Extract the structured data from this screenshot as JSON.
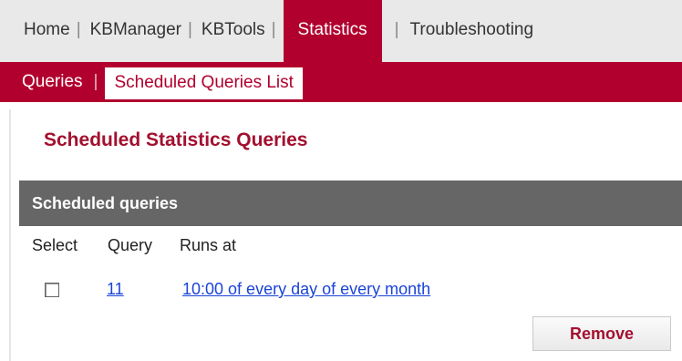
{
  "nav": {
    "tabs": [
      {
        "label": "Home"
      },
      {
        "label": "KBManager"
      },
      {
        "label": "KBTools"
      },
      {
        "label": "Statistics"
      },
      {
        "label": "Troubleshooting"
      }
    ],
    "separator": "|"
  },
  "subnav": {
    "items": [
      {
        "label": "Queries"
      },
      {
        "label": "Scheduled Queries List"
      }
    ],
    "separator": "|"
  },
  "page": {
    "title": "Scheduled Statistics Queries",
    "section_title": "Scheduled queries",
    "columns": [
      "Select",
      "Query",
      "Runs at"
    ],
    "rows": [
      {
        "query": "11",
        "runs_at": "10:00 of every day of every month"
      }
    ],
    "remove_label": "Remove"
  },
  "colors": {
    "accent": "#b1002e",
    "section_header_bg": "#666666",
    "link": "#1a44d8"
  }
}
